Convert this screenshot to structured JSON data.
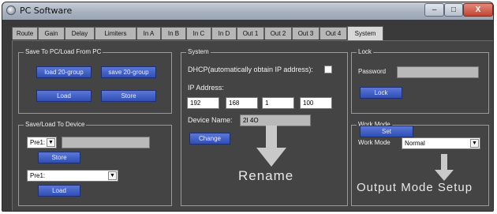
{
  "window": {
    "title": "PC Software",
    "controls": {
      "minimize": "–",
      "maximize": "□",
      "close": "X"
    }
  },
  "tabs": [
    "Route",
    "Gain",
    "Delay",
    "Limiters",
    "In A",
    "In B",
    "In C",
    "In D",
    "Out 1",
    "Out 2",
    "Out 3",
    "Out 4",
    "System"
  ],
  "active_tab": "System",
  "save_pc": {
    "title": "Save To PC/Load From PC",
    "load20_label": "load 20-group",
    "save20_label": "save 20-group",
    "load_label": "Load",
    "store_label": "Store"
  },
  "save_device": {
    "title": "Save/Load To Device",
    "preset1": "Pre1:",
    "preset1_name": "",
    "store_label": "Store",
    "preset2": "Pre1:",
    "load_label": "Load"
  },
  "system": {
    "title": "System",
    "dhcp_label": "DHCP(automatically obtain IP address):",
    "ip_label": "IP Address:",
    "ip": [
      "192",
      "168",
      "1",
      "100"
    ],
    "device_name_label": "Device Name:",
    "device_name": "2I 4O",
    "change_label": "Change"
  },
  "lock": {
    "title": "Lock",
    "password_label": "Password",
    "password_value": "",
    "lock_label": "Lock"
  },
  "work_mode": {
    "title": "Work Mode",
    "label": "Work Mode",
    "value": "Normal",
    "set_label": "Set"
  },
  "annotations": {
    "rename": "Rename",
    "output_mode": "Output Mode Setup"
  },
  "colors": {
    "button_top": "#5b77d8",
    "button_bottom": "#2f4fb5",
    "panel_bg": "#444444",
    "annotation": "#e8e8e8"
  }
}
